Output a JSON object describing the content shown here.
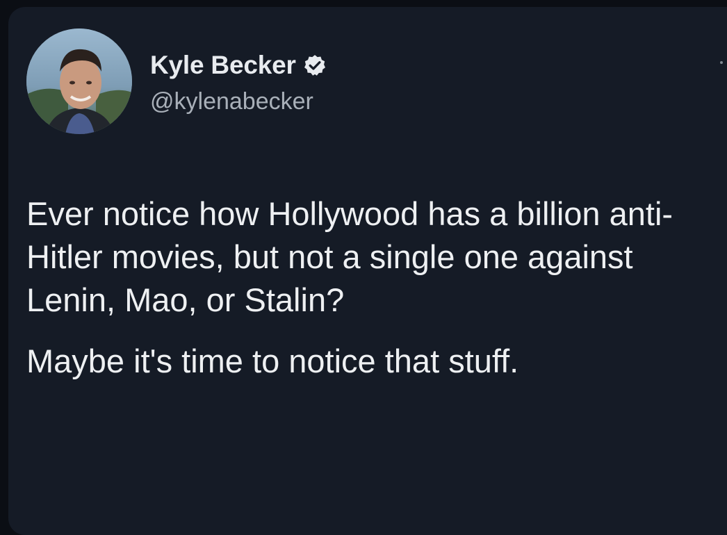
{
  "tweet": {
    "author": {
      "display_name": "Kyle Becker",
      "handle": "@kylenabecker",
      "verified": true,
      "avatar_icon": "profile-photo"
    },
    "more_icon": "more-options-icon",
    "text_paragraphs": [
      "Ever notice how Hollywood has a billion anti-Hitler movies, but not a single one against Lenin, Mao, or Stalin?",
      "Maybe it's time to notice that stuff."
    ]
  },
  "colors": {
    "background": "#151b26",
    "text": "#eef0f2",
    "handle": "#a9b0b9",
    "verified": "#e8ebef"
  }
}
